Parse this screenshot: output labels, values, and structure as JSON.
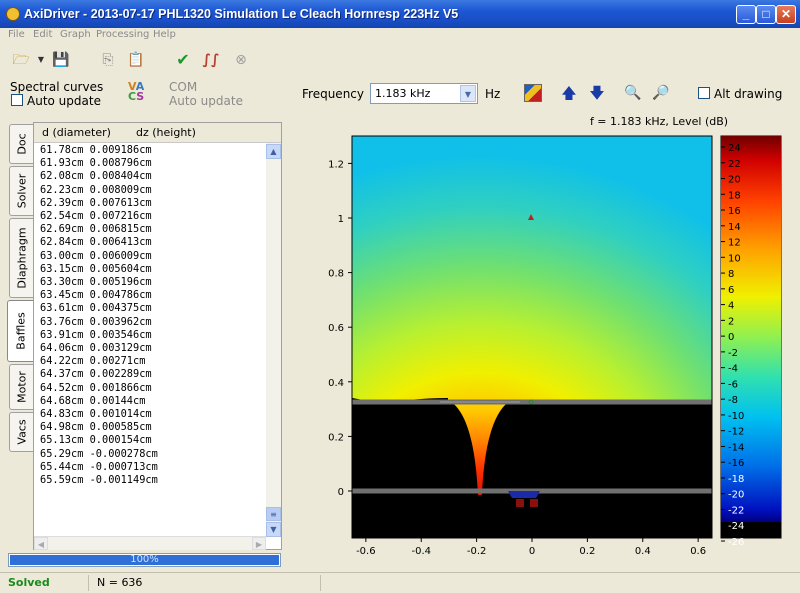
{
  "window": {
    "title": "AxiDriver - 2013-07-17 PHL1320 Simulation Le Cleach Hornresp 223Hz V5"
  },
  "menu": [
    "File",
    "Edit",
    "Graph",
    "Processing",
    "Help"
  ],
  "controls": {
    "spectral_curves": "Spectral curves",
    "auto_update": "Auto update",
    "com": "COM",
    "com_auto_update": "Auto update",
    "frequency_label": "Frequency",
    "frequency_value": "1.183 kHz",
    "hz_unit": "Hz",
    "alt_drawing": "Alt drawing"
  },
  "tabs": [
    "Doc",
    "Solver",
    "Diaphragm",
    "Baffles",
    "Motor",
    "Vacs"
  ],
  "active_tab": "Baffles",
  "list": {
    "headers": [
      "d (diameter)",
      "dz (height)"
    ],
    "rows": [
      "61.78cm 0.009186cm",
      "61.93cm 0.008796cm",
      "62.08cm 0.008404cm",
      "62.23cm 0.008009cm",
      "62.39cm 0.007613cm",
      "62.54cm 0.007216cm",
      "62.69cm 0.006815cm",
      "62.84cm 0.006413cm",
      "63.00cm 0.006009cm",
      "63.15cm 0.005604cm",
      "63.30cm 0.005196cm",
      "63.45cm 0.004786cm",
      "63.61cm 0.004375cm",
      "63.76cm 0.003962cm",
      "63.91cm 0.003546cm",
      "64.06cm 0.003129cm",
      "64.22cm 0.00271cm",
      "64.37cm 0.002289cm",
      "64.52cm 0.001866cm",
      "64.68cm 0.00144cm",
      "64.83cm 0.001014cm",
      "64.98cm 0.000585cm",
      "65.13cm 0.000154cm",
      "65.29cm -0.000278cm",
      "65.44cm -0.000713cm",
      "65.59cm -0.001149cm"
    ]
  },
  "progress": {
    "value": 1.0,
    "label": "100%"
  },
  "status": {
    "state": "Solved",
    "count": "N = 636"
  },
  "plot": {
    "title": "f = 1.183 kHz, Level  (dB)",
    "x_ticks": [
      "-0.6",
      "-0.4",
      "-0.2",
      "0",
      "0.2",
      "0.4",
      "0.6"
    ],
    "y_ticks": [
      "0",
      "0.2",
      "0.4",
      "0.6",
      "0.8",
      "1",
      "1.2"
    ],
    "colorbar_ticks": [
      "24",
      "22",
      "20",
      "18",
      "16",
      "14",
      "12",
      "10",
      "8",
      "6",
      "4",
      "2",
      "0",
      "-2",
      "-4",
      "-6",
      "-8",
      "-10",
      "-12",
      "-14",
      "-16",
      "-18",
      "-20",
      "-22",
      "-24",
      "-26"
    ],
    "colors": {
      "cold": "#00c8e8",
      "warm": "#f8e000",
      "hot": "#e00000",
      "baffle": "#000000",
      "rod": "#808080"
    }
  }
}
